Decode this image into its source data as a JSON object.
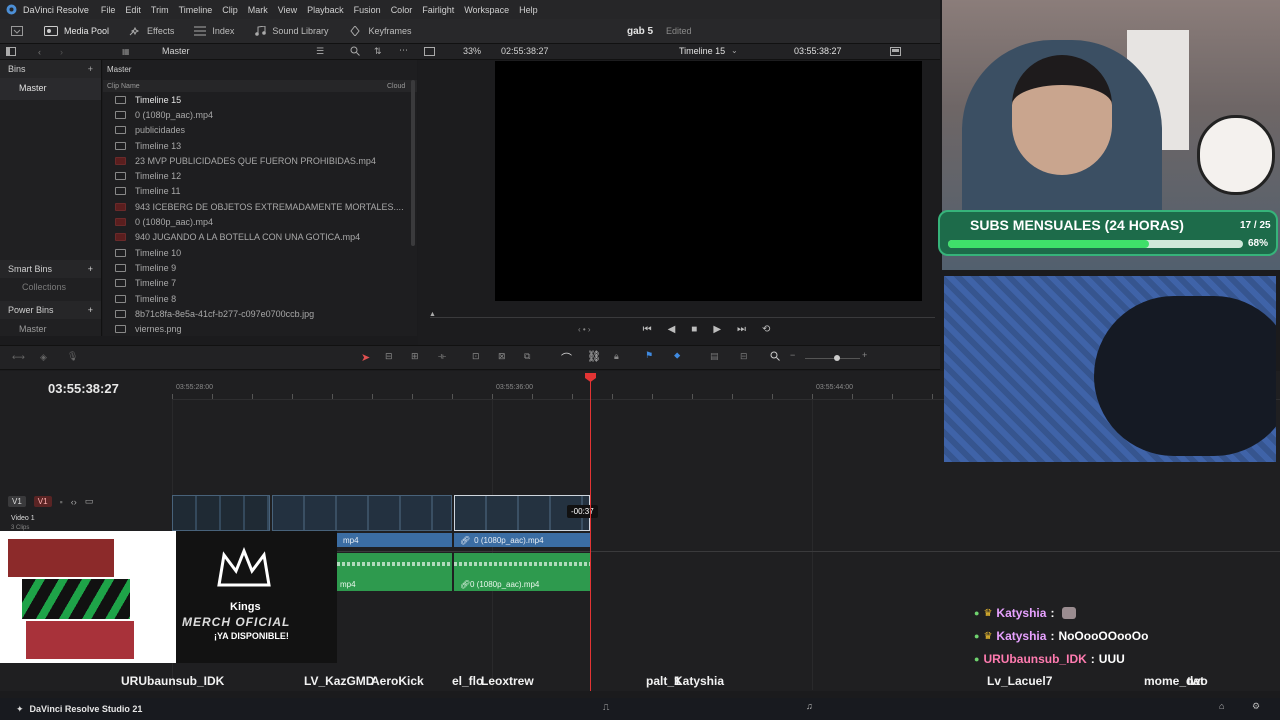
{
  "app": {
    "name": "DaVinci Resolve",
    "project_title": "gab 5",
    "status": "Edited"
  },
  "menu": [
    "File",
    "Edit",
    "Trim",
    "Timeline",
    "Clip",
    "Mark",
    "View",
    "Playback",
    "Fusion",
    "Color",
    "Fairlight",
    "Workspace",
    "Help"
  ],
  "toolbar": {
    "media_pool": "Media Pool",
    "effects": "Effects",
    "index": "Index",
    "sound_library": "Sound Library",
    "keyframes": "Keyframes"
  },
  "viewer_bar": {
    "bin": "Master",
    "zoom": "33%",
    "source_tc": "02:55:38:27",
    "timeline_name": "Timeline 15",
    "record_tc": "03:55:38:27"
  },
  "bins": {
    "title": "Bins",
    "master": "Master",
    "smart_bins": "Smart Bins",
    "collections": "Collections",
    "power_bins": "Power Bins",
    "power_master": "Master"
  },
  "clip_list": {
    "breadcrumb": "Master",
    "col_name": "Clip Name",
    "col_cloud": "Cloud",
    "items": [
      "Timeline 15",
      "0 (1080p_aac).mp4",
      "publicidades",
      "Timeline 13",
      "23 MVP PUBLICIDADES QUE FUERON PROHIBIDAS.mp4",
      "Timeline 12",
      "Timeline 11",
      "943 ICEBERG DE OBJETOS EXTREMADAMENTE MORTALES....",
      "0 (1080p_aac).mp4",
      "940 JUGANDO A LA BOTELLA CON UNA GOTICA.mp4",
      "Timeline 10",
      "Timeline 9",
      "Timeline 7",
      "Timeline 8",
      "8b71c8fa-8e5a-41cf-b277-c097e0700ccb.jpg",
      "viernes.png"
    ]
  },
  "timeline": {
    "timecode": "03:55:38:27",
    "ruler": [
      "03:55:28:00",
      "03:55:36:00",
      "03:55:44:00"
    ],
    "track_v1": "V1",
    "track_name": "Video 1",
    "track_clips": "3 Clips",
    "trim_tooltip": "-00:37",
    "clip_label_a": "mp4",
    "clip_label_b": "0 (1080p_aac).mp4",
    "audio_label_a": "mp4",
    "audio_label_b": "0 (1080p_aac).mp4"
  },
  "stream": {
    "subs_title": "SUBS MENSUALES (24 HORAS)",
    "subs_count": "17 / 25",
    "subs_pct_text": "68%",
    "subs_progress": 0.68,
    "merch_brand": "Kings",
    "merch_line1": "MERCH OFICIAL",
    "merch_line2": "¡YA DISPONIBLE!",
    "chat": [
      {
        "user": "Katyshia",
        "sep": ":",
        "msg": "",
        "color": "#e7a1ff"
      },
      {
        "user": "Katyshia",
        "sep": ":",
        "msg": "NoOooOOooOo",
        "color": "#e7a1ff"
      },
      {
        "user": "URUbaunsub_IDK",
        "sep": ":",
        "msg": "UUU",
        "color": "#ff7bb0"
      }
    ],
    "viewers": [
      "URUbaunsub_IDK",
      "LV_KazGMD",
      "AeroKick",
      "el_flo",
      "Leoxtrew",
      "palt_1",
      "Katyshia",
      "Lv_Lacuel7",
      "mome_dat",
      "two"
    ]
  },
  "taskbar": {
    "app_label": "DaVinci Resolve Studio 21"
  }
}
